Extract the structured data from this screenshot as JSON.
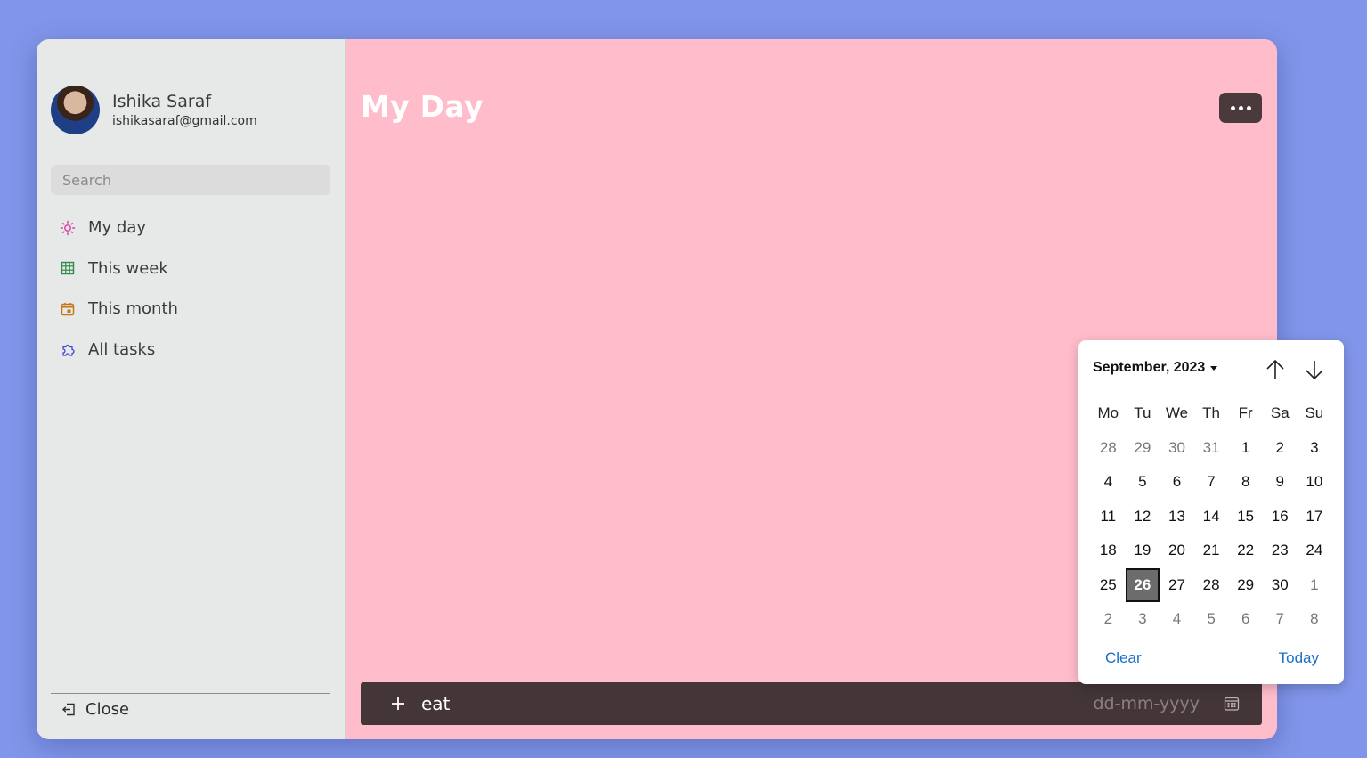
{
  "user": {
    "name": "Ishika Saraf",
    "email": "ishikasaraf@gmail.com"
  },
  "search": {
    "placeholder": "Search"
  },
  "nav": {
    "items": [
      {
        "label": "My day",
        "icon": "sun-icon",
        "color": "#d63aa4"
      },
      {
        "label": "This week",
        "icon": "grid-icon",
        "color": "#2f8a4c"
      },
      {
        "label": "This month",
        "icon": "calendar-icon",
        "color": "#c57717"
      },
      {
        "label": "All tasks",
        "icon": "puzzle-icon",
        "color": "#3b45d6"
      }
    ]
  },
  "sidebar": {
    "close_label": "Close"
  },
  "main": {
    "title": "My Day",
    "background": "#ffbdcb"
  },
  "taskbar": {
    "input_value": "eat",
    "date_placeholder": "dd-mm-yyyy"
  },
  "datepicker": {
    "month_label": "September, 2023",
    "weekdays": [
      "Mo",
      "Tu",
      "We",
      "Th",
      "Fr",
      "Sa",
      "Su"
    ],
    "weeks": [
      [
        "28",
        "29",
        "30",
        "31",
        "1",
        "2",
        "3"
      ],
      [
        "4",
        "5",
        "6",
        "7",
        "8",
        "9",
        "10"
      ],
      [
        "11",
        "12",
        "13",
        "14",
        "15",
        "16",
        "17"
      ],
      [
        "18",
        "19",
        "20",
        "21",
        "22",
        "23",
        "24"
      ],
      [
        "25",
        "26",
        "27",
        "28",
        "29",
        "30",
        "1"
      ],
      [
        "2",
        "3",
        "4",
        "5",
        "6",
        "7",
        "8"
      ]
    ],
    "selected_day": "26",
    "clear_label": "Clear",
    "today_label": "Today"
  }
}
